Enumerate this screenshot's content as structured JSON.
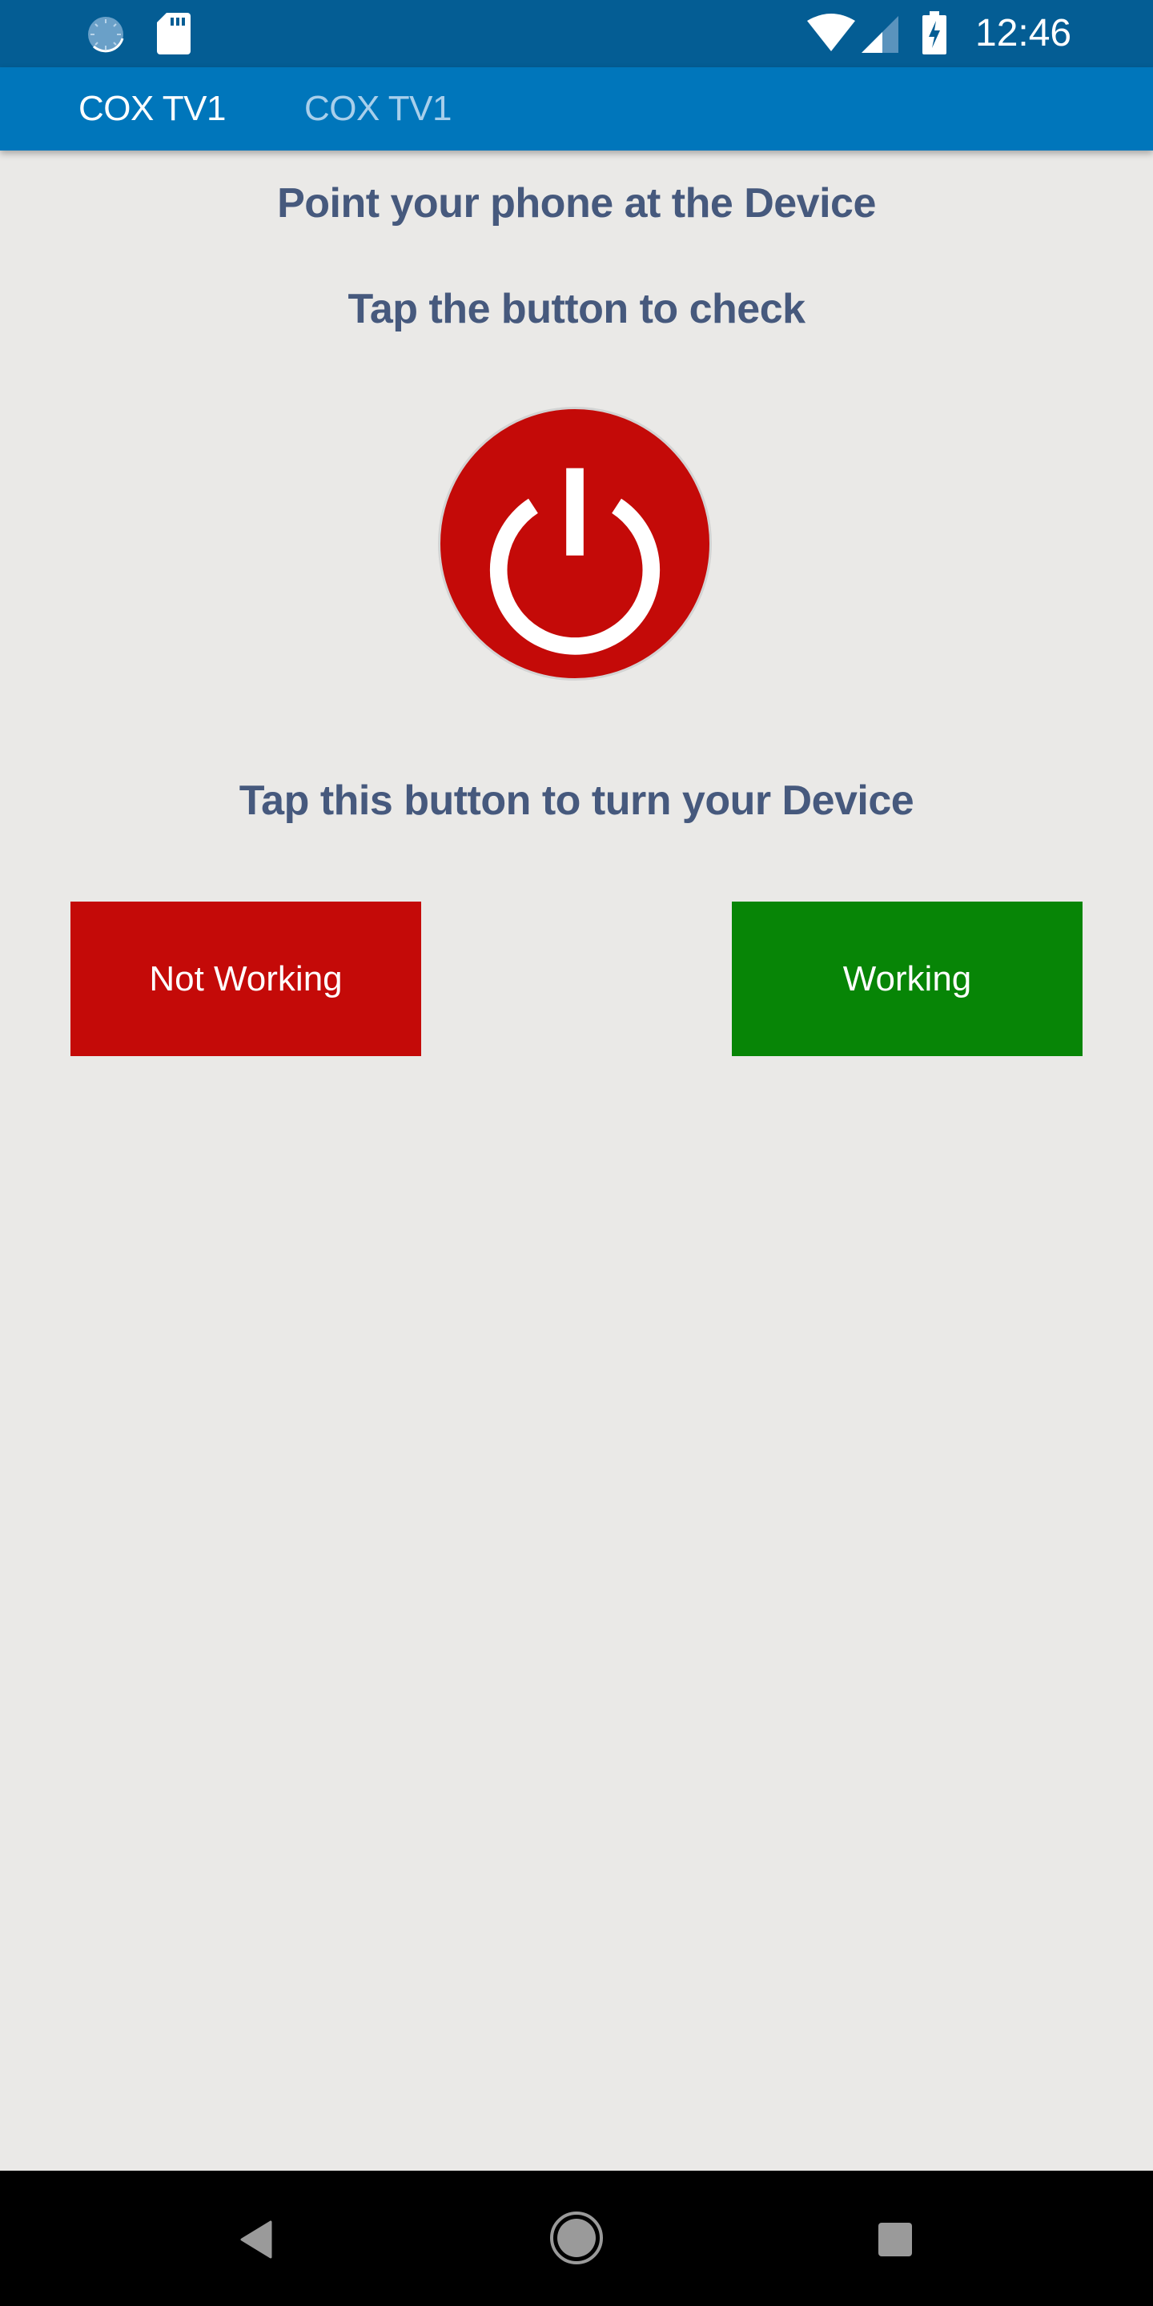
{
  "status_bar": {
    "time": "12:46",
    "left_icons": [
      "sync-icon",
      "sd-card-icon"
    ],
    "right_icons": [
      "wifi-icon",
      "cell-signal-icon",
      "battery-charging-icon"
    ]
  },
  "app_bar": {
    "tabs": [
      {
        "label": "COX TV1",
        "active": true
      },
      {
        "label": "COX TV1",
        "active": false
      }
    ],
    "background_color": "#0076bb"
  },
  "main": {
    "instruction_1": "Point your phone at the Device",
    "instruction_2": "Tap the button to check",
    "power_button_icon": "power-icon",
    "instruction_3": "Tap this button to turn your Device",
    "buttons": {
      "not_working": {
        "label": "Not Working",
        "color": "#c40a08"
      },
      "working": {
        "label": "Working",
        "color": "#078506"
      }
    }
  },
  "nav_bar": {
    "buttons": [
      "back-icon",
      "home-icon",
      "recents-icon"
    ]
  }
}
